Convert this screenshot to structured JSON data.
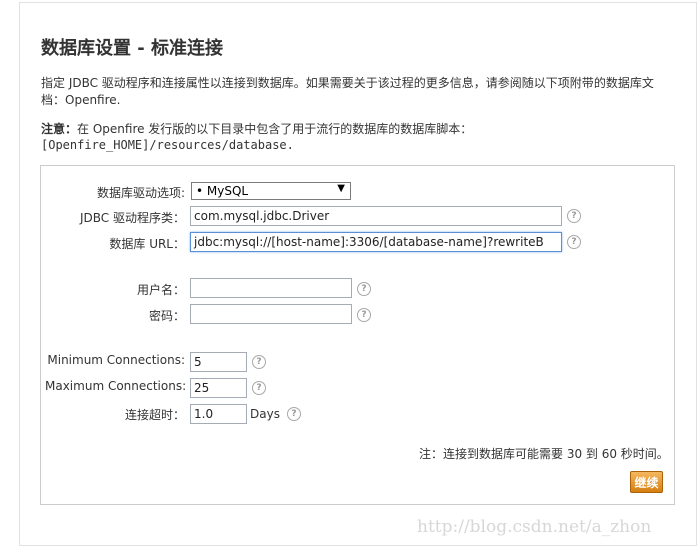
{
  "page": {
    "title": "数据库设置 - 标准连接",
    "intro": "指定 JDBC 驱动程序和连接属性以连接到数据库。如果需要关于该过程的更多信息，请参阅随以下项附带的数据库文档：Openfire.",
    "note_label": "注意：",
    "note_text": "在 Openfire 发行版的以下目录中包含了用于流行的数据库的数据库脚本：",
    "note_path": "[Openfire_HOME]/resources/database."
  },
  "form": {
    "driver_preset_label": "数据库驱动选项:",
    "driver_preset_value": "• MySQL",
    "driver_class_label": "JDBC 驱动程序类：",
    "driver_class_value": "com.mysql.jdbc.Driver",
    "db_url_label": "数据库 URL：",
    "db_url_value": "jdbc:mysql://[host-name]:3306/[database-name]?rewriteB",
    "username_label": "用户名：",
    "username_value": "",
    "password_label": "密码：",
    "password_value": "",
    "min_conn_label": "Minimum Connections:",
    "min_conn_value": "5",
    "max_conn_label": "Maximum Connections:",
    "max_conn_value": "25",
    "timeout_label": "连接超时：",
    "timeout_value": "1.0",
    "timeout_unit": "Days",
    "help_glyph": "?",
    "footnote": "注：连接到数据库可能需要 30 到 60 秒时间。",
    "continue_label": "继续"
  },
  "watermark": "http://blog.csdn.net/a_zhon"
}
